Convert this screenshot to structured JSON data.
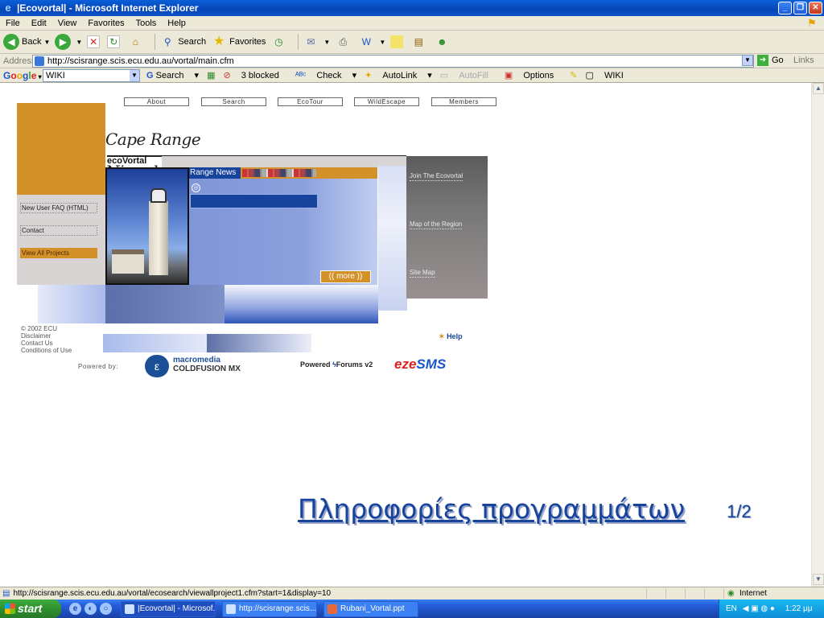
{
  "window": {
    "title": "|Ecovortal| - Microsoft Internet Explorer"
  },
  "menu": [
    "File",
    "Edit",
    "View",
    "Favorites",
    "Tools",
    "Help"
  ],
  "toolbar": {
    "back": "Back",
    "search": "Search",
    "favorites": "Favorites"
  },
  "address": {
    "label": "Address",
    "url": "http://scisrange.scis.ecu.edu.au/vortal/main.cfm",
    "go": "Go",
    "links": "Links"
  },
  "google": {
    "search_value": "WIKI",
    "search": "Search",
    "blocked": "3 blocked",
    "check": "Check",
    "autolink": "AutoLink",
    "autofill": "AutoFill",
    "options": "Options",
    "wiki": "WIKI"
  },
  "page": {
    "nav": [
      "About",
      "Search",
      "EcoTour",
      "WildEscape",
      "Members"
    ],
    "logo_script": "Cape Range Ningaloo",
    "logo_sub": "ecoVortal",
    "news_title": "Range News",
    "more": "(( more ))",
    "side_links": [
      "New User FAQ (HTML)",
      "Contact",
      "View All Projects"
    ],
    "right_nav": [
      "Join The Ecovortal",
      "Map of the Region",
      "Site Map"
    ],
    "footer_links": [
      "© 2002 ECU",
      "Disclaimer",
      "Contact Us",
      "Conditions of Use"
    ],
    "help": "Help",
    "powered_by": "Powered by:",
    "macromedia_1": "macromedia",
    "macromedia_2": "COLDFUSION MX",
    "powered_forums": "Powered",
    "forums": "Forums v2",
    "eze": "eze",
    "sms": "SMS",
    "overlay_title": "Πληροφορίες προγραμμάτων",
    "overlay_page": "1/2"
  },
  "status": {
    "url": "http://scisrange.scis.ecu.edu.au/vortal/ecosearch/viewallproject1.cfm?start=1&display=10",
    "zone": "Internet"
  },
  "taskbar": {
    "start": "start",
    "tasks": [
      "|Ecovortal| - Microsof...",
      "http://scisrange.scis....",
      "Rubani_Vortal.ppt"
    ],
    "lang": "EN",
    "clock": "1:22 μμ"
  },
  "colors": {
    "accent": "#d4912a",
    "panel_blue": "#7f96d8",
    "dark_blue": "#16439c"
  }
}
